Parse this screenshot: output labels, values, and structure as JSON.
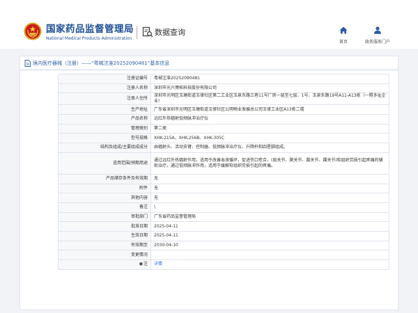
{
  "header": {
    "org_cn": "国家药品监督管理局",
    "org_en": "National Medical Products Administration",
    "data_query": "数据查询",
    "nav": [
      {
        "label": "首页",
        "icon": "home-icon"
      },
      {
        "label": "政务服务门户",
        "icon": "user-icon"
      }
    ]
  },
  "breadcrumb": {
    "icon": "document-icon",
    "text": "境内医疗器械（注册）——“粤械注准20252090481”基本信息"
  },
  "detail": {
    "rows": [
      {
        "label": "注册证编号",
        "value": "粤械注准20252090481"
      },
      {
        "label": "注册人名称",
        "value": "深圳市光兴博拓科技股份有限公司"
      },
      {
        "label": "注册人住所",
        "value": "深圳市光明区玉塘街道玉律社区第二工业区玉泉东路三巷11号厂房一层至七层、1号、玉泉东路19号A11-A13栋（一照多址企业）"
      },
      {
        "label": "生产地址",
        "value": "广东省深圳市光明区玉塘街道玉律社区公明物业发展总公司玉律工业区A13栋二楼"
      },
      {
        "label": "产品名称",
        "value": "远红外热辐射低频脉冲治疗仪"
      },
      {
        "label": "管理类别",
        "value": "第二类"
      },
      {
        "label": "型号规格",
        "value": "XHK-215A、XHK-256B、XHK-305C"
      },
      {
        "label": "结构及组成/主要组成成分",
        "value": "由辐射头、活动支臂、控制器、低频脉冲治疗仪、升降杆和四星脚组成。"
      },
      {
        "label": "适用范围/预期用途",
        "value": "通过远红外热辐射作用，适用于改善血液循环，促进伤口愈合，(肩关节、腕关节、膝关节、踝关节)软组织劳损引起疼痛的辅助治疗。通过低频脉冲作用，适用于缓解软组织劳损引起的疼痛。"
      },
      {
        "label": "产品储存条件及有效期",
        "value": "无"
      },
      {
        "label": "附件",
        "value": "无"
      },
      {
        "label": "其他内容",
        "value": "无"
      },
      {
        "label": "备注",
        "value": "\\"
      },
      {
        "label": "审批部门",
        "value": "广东省药品监督管理局"
      },
      {
        "label": "批准日期",
        "value": "2025-04-11"
      },
      {
        "label": "生效日期",
        "value": "2025-04-11"
      },
      {
        "label": "有效期至",
        "value": "2030-04-10"
      },
      {
        "label": "变更情况",
        "value": ""
      },
      {
        "label": "注",
        "bullet": "●",
        "value": "详情",
        "link": true
      }
    ]
  }
}
